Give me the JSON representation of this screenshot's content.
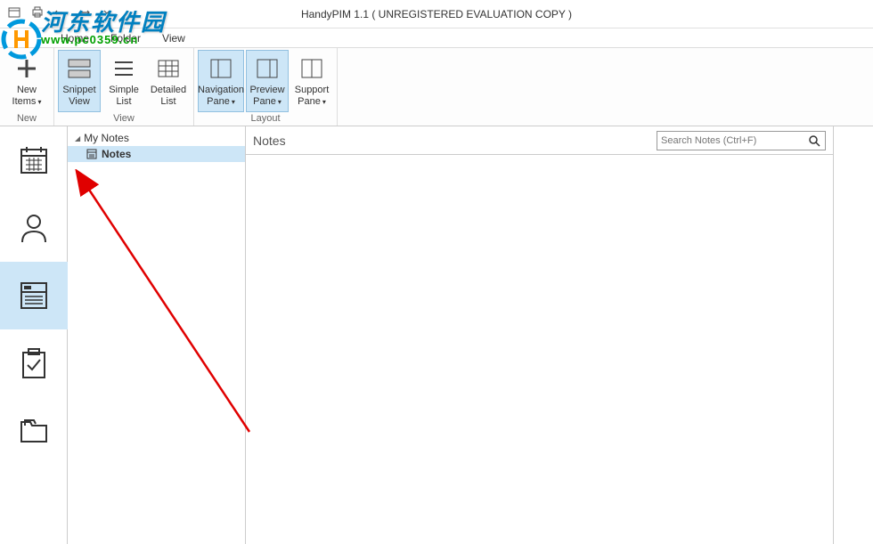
{
  "window": {
    "title": "HandyPIM 1.1 ( UNREGISTERED EVALUATION COPY )"
  },
  "menu": {
    "home": "Home",
    "folder": "Folder",
    "view": "View"
  },
  "ribbon": {
    "new_items": "New\nItems",
    "new_group": "New",
    "snippet_view": "Snippet\nView",
    "simple_list": "Simple\nList",
    "detailed_list": "Detailed\nList",
    "view_group": "View",
    "navigation_pane": "Navigation\nPane",
    "preview_pane": "Preview\nPane",
    "support_pane": "Support\nPane",
    "layout_group": "Layout"
  },
  "tree": {
    "root": "My Notes",
    "child": "Notes"
  },
  "content": {
    "title": "Notes",
    "search_placeholder": "Search Notes (Ctrl+F)"
  },
  "watermark": {
    "text": "河东软件园",
    "url": "www.pc0359.cn"
  }
}
